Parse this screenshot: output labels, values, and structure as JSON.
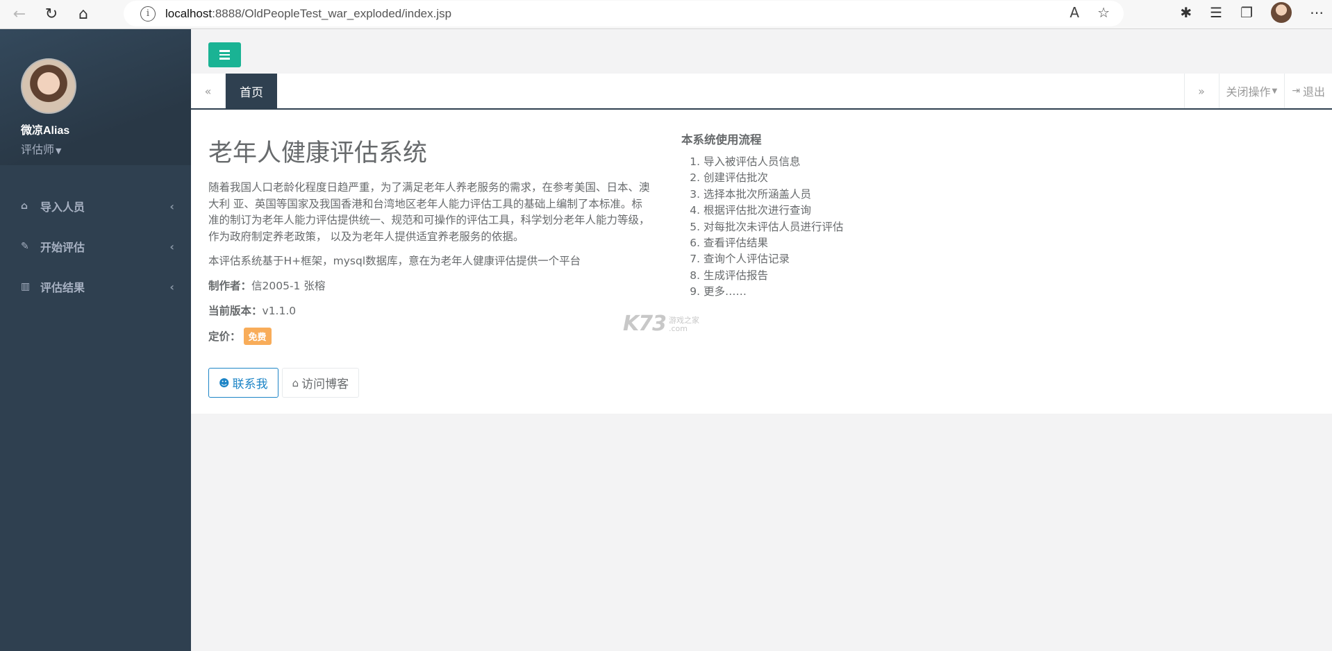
{
  "browser": {
    "url_host": "localhost",
    "url_rest": ":8888/OldPeopleTest_war_exploded/index.jsp",
    "info_glyph": "i"
  },
  "sidebar": {
    "user_name": "微凉Alias",
    "user_role": "评估师",
    "menu": [
      {
        "label": "导入人员",
        "icon": "home-icon"
      },
      {
        "label": "开始评估",
        "icon": "edit-icon"
      },
      {
        "label": "评估结果",
        "icon": "bar-chart-icon"
      }
    ]
  },
  "tabs": {
    "home": "首页",
    "close_ops": "关闭操作",
    "logout": "退出"
  },
  "main": {
    "title": "老年人健康评估系统",
    "intro": "随着我国人口老龄化程度日趋严重，为了满足老年人养老服务的需求，在参考美国、日本、澳大利 亚、英国等国家及我国香港和台湾地区老年人能力评估工具的基础上编制了本标准。标准的制订为老年人能力评估提供统一、规范和可操作的评估工具，科学划分老年人能力等级，作为政府制定养老政策， 以及为老年人提供适宜养老服务的依据。",
    "basis": "本评估系统基于H+框架，mysql数据库，意在为老年人健康评估提供一个平台",
    "author_label": "制作者：",
    "author_value": "信2005-1 张榕",
    "version_label": "当前版本：",
    "version_value": "v1.1.0",
    "price_label": "定价：",
    "price_badge": "免费",
    "contact_button": "联系我",
    "blog_button": "访问博客"
  },
  "flow": {
    "title": "本系统使用流程",
    "steps": [
      "导入被评估人员信息",
      "创建评估批次",
      "选择本批次所涵盖人员",
      "根据评估批次进行查询",
      "对每批次未评估人员进行评估",
      "查看评估结果",
      "查询个人评估记录",
      "生成评估报告",
      "更多……"
    ]
  },
  "watermark": {
    "big": "K73",
    "small": "游戏之家",
    "com": ".com"
  },
  "colors": {
    "sidebar_bg": "#2f4050",
    "accent_green": "#1ab394",
    "primary_blue": "#1c84c6",
    "badge_orange": "#f8ac59"
  }
}
